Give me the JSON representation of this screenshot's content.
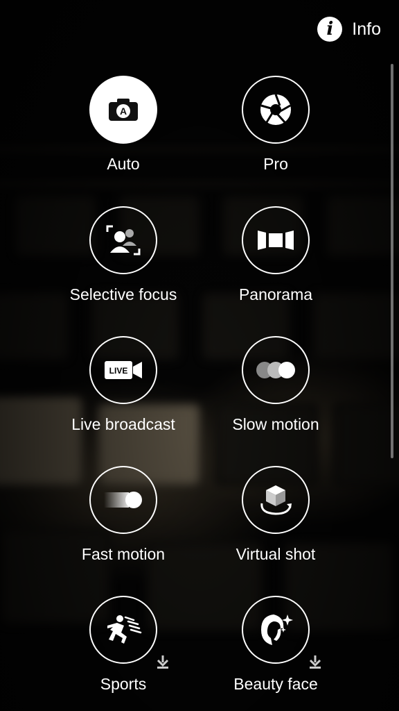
{
  "info": {
    "label": "Info",
    "icon": "info-icon"
  },
  "modes": [
    {
      "id": "auto",
      "label": "Auto",
      "icon": "camera-auto-icon",
      "selected": true
    },
    {
      "id": "pro",
      "label": "Pro",
      "icon": "aperture-icon",
      "selected": false
    },
    {
      "id": "selective-focus",
      "label": "Selective focus",
      "icon": "selective-focus-icon",
      "selected": false
    },
    {
      "id": "panorama",
      "label": "Panorama",
      "icon": "panorama-icon",
      "selected": false
    },
    {
      "id": "live-broadcast",
      "label": "Live broadcast",
      "icon": "live-camera-icon",
      "badge": "LIVE",
      "selected": false
    },
    {
      "id": "slow-motion",
      "label": "Slow motion",
      "icon": "slow-motion-icon",
      "selected": false
    },
    {
      "id": "fast-motion",
      "label": "Fast motion",
      "icon": "fast-motion-icon",
      "selected": false
    },
    {
      "id": "virtual-shot",
      "label": "Virtual shot",
      "icon": "virtual-shot-icon",
      "selected": false
    },
    {
      "id": "sports",
      "label": "Sports",
      "icon": "sports-runner-icon",
      "downloadable": true,
      "selected": false
    },
    {
      "id": "beauty-face",
      "label": "Beauty face",
      "icon": "beauty-face-icon",
      "downloadable": true,
      "selected": false
    }
  ]
}
